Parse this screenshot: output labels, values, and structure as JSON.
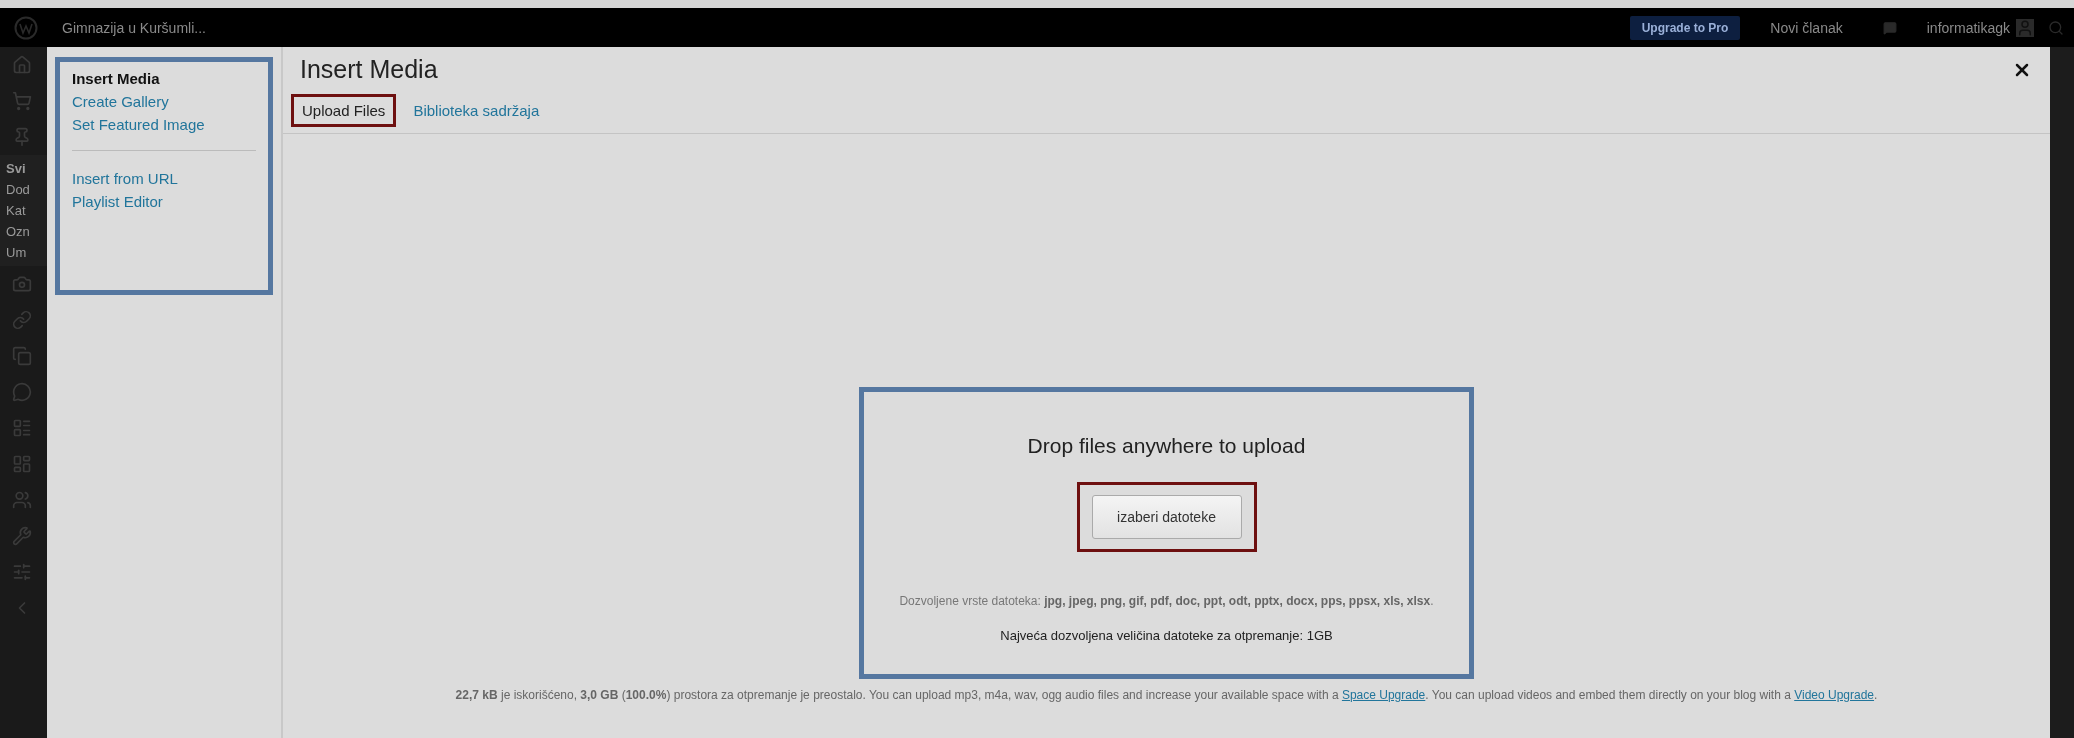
{
  "admin_bar": {
    "site_name": "Gimnazija u Kuršumli...",
    "upgrade": "Upgrade to Pro",
    "new_post": "Novi članak",
    "user": "informatikagk"
  },
  "admin_menu": {
    "submenu": [
      "Svi",
      "Dod",
      "Kat",
      "Ozn",
      "Um"
    ]
  },
  "modal": {
    "title": "Insert Media",
    "sidebar": {
      "groups": [
        [
          {
            "label": "Insert Media",
            "selected": true
          },
          {
            "label": "Create Gallery",
            "selected": false
          },
          {
            "label": "Set Featured Image",
            "selected": false
          }
        ],
        [
          {
            "label": "Insert from URL",
            "selected": false
          },
          {
            "label": "Playlist Editor",
            "selected": false
          }
        ]
      ]
    },
    "tabs": [
      {
        "label": "Upload Files",
        "selected": true
      },
      {
        "label": "Biblioteka sadržaja",
        "selected": false
      }
    ],
    "upload": {
      "heading": "Drop files anywhere to upload",
      "button": "izaberi datoteke",
      "allowed_types": "Dozvoljene vrste datoteka: **jpg, jpeg, png, gif, pdf, doc, ppt, odt, pptx, docx, pps, ppsx, xls, xlsx**.",
      "max_size": "Najveća dozvoljena veličina datoteke za otpremanje: 1GB"
    },
    "footer": [
      {
        "kind": "text",
        "text": "**22,7 kB** je iskorišćeno, **3,0 GB** (**100.0%**) prostora za otpremanje je preostalo. You can upload mp3, m4a, wav, ogg audio files and increase your available space with a "
      },
      {
        "kind": "link",
        "text": "Space Upgrade"
      },
      {
        "kind": "text",
        "text": ". You can upload videos and embed them directly on your blog with a "
      },
      {
        "kind": "link",
        "text": "Video Upgrade"
      },
      {
        "kind": "text",
        "text": "."
      }
    ]
  }
}
